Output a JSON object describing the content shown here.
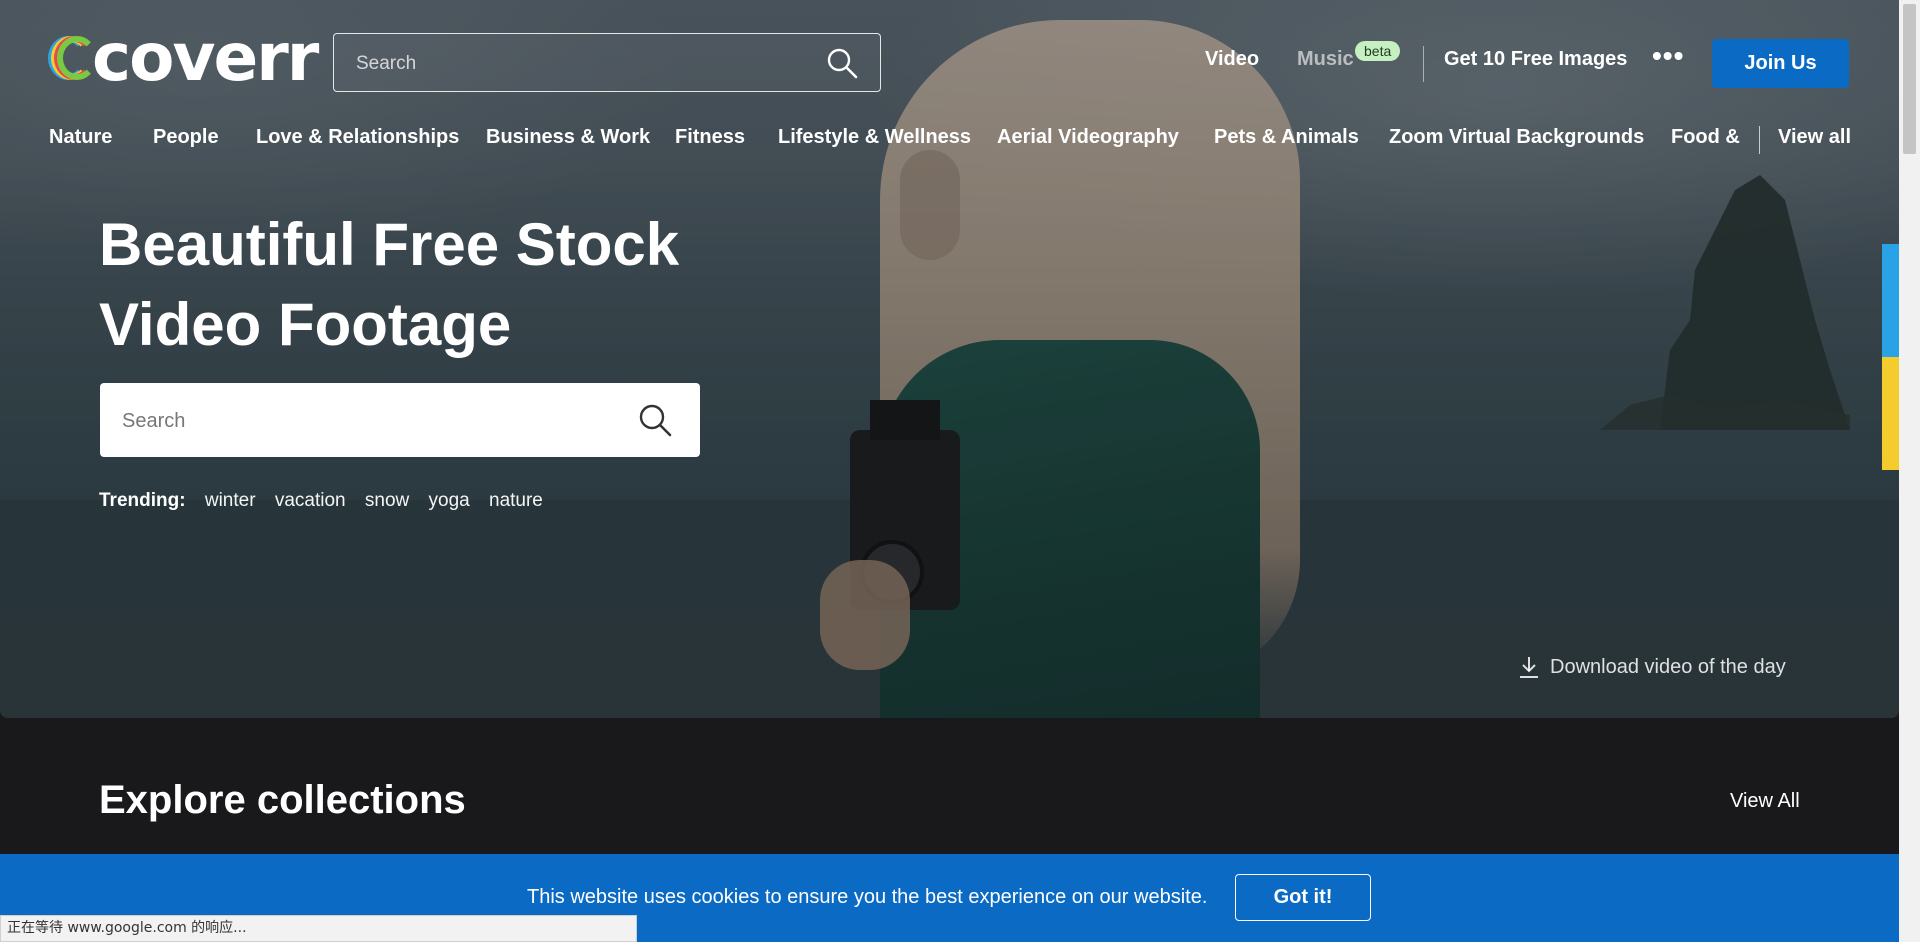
{
  "header": {
    "logo_text": "coverr",
    "search_placeholder": "Search",
    "nav": {
      "video": "Video",
      "music": "Music",
      "beta": "beta",
      "free_images": "Get 10 Free Images",
      "more": "•••",
      "join": "Join Us"
    },
    "categories": [
      "Nature",
      "People",
      "Love & Relationships",
      "Business & Work",
      "Fitness",
      "Lifestyle & Wellness",
      "Aerial Videography",
      "Pets & Animals",
      "Zoom Virtual Backgrounds",
      "Food &"
    ],
    "view_all": "View all"
  },
  "hero": {
    "title_line1": "Beautiful Free Stock",
    "title_line2": "Video Footage",
    "search_placeholder": "Search",
    "trending_label": "Trending:",
    "trending": [
      "winter",
      "vacation",
      "snow",
      "yoga",
      "nature"
    ],
    "download_day": "Download video of the day"
  },
  "explore": {
    "title": "Explore collections",
    "view_all": "View All"
  },
  "cookie": {
    "text": "This website uses cookies to ensure you the best experience on our website.",
    "button": "Got it!"
  },
  "status_bar": {
    "text": "正在等待 www.google.com 的响应..."
  },
  "colors": {
    "brand_blue": "#0a6ac4",
    "beta_badge": "#c6f0c2",
    "logo_rings": [
      "#2aa3e6",
      "#f5cc2e",
      "#e84b4b",
      "#7ac943"
    ]
  },
  "icons": {
    "search": "search-icon",
    "download": "download-icon",
    "more": "more-dots-icon"
  }
}
